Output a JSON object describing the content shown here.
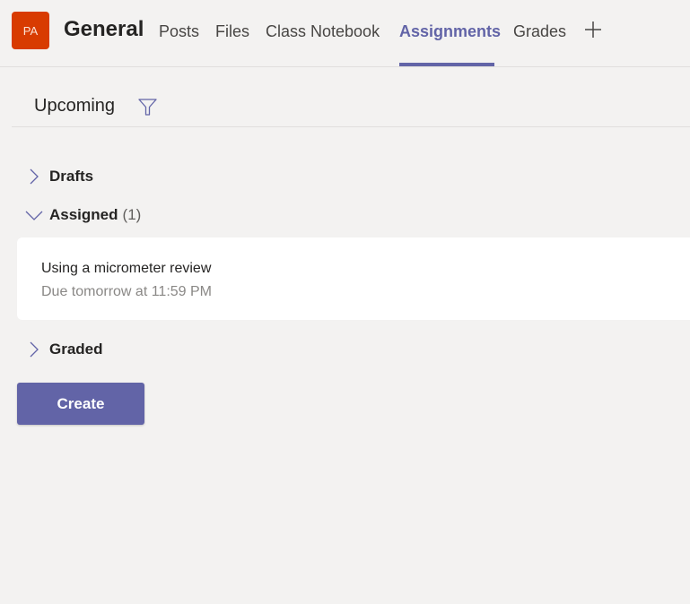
{
  "header": {
    "avatar_initials": "PA",
    "avatar_color": "#d83b01",
    "title": "General",
    "tabs": [
      {
        "label": "Posts",
        "active": false
      },
      {
        "label": "Files",
        "active": false
      },
      {
        "label": "Class Notebook",
        "active": false
      },
      {
        "label": "Assignments",
        "active": true
      },
      {
        "label": "Grades",
        "active": false
      }
    ],
    "add_tab_icon": "plus-icon",
    "accent_color": "#6264a7"
  },
  "filter_bar": {
    "label": "Upcoming",
    "icon": "filter-icon"
  },
  "sections": {
    "drafts": {
      "label": "Drafts",
      "expanded": false
    },
    "assigned": {
      "label": "Assigned",
      "count": "(1)",
      "expanded": true
    },
    "graded": {
      "label": "Graded",
      "expanded": false
    }
  },
  "assignments": [
    {
      "title": "Using a micrometer review",
      "due": "Due tomorrow at 11:59 PM"
    }
  ],
  "actions": {
    "create_label": "Create"
  }
}
